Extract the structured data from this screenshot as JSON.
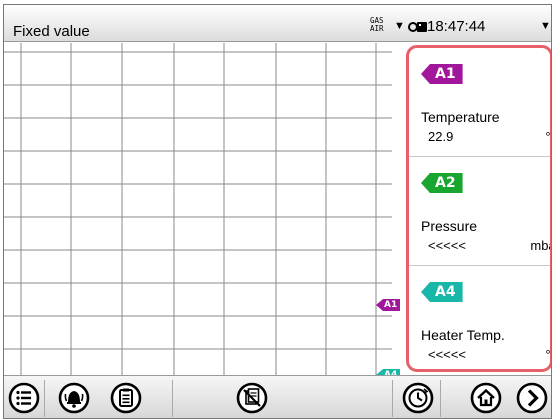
{
  "header": {
    "title": "Fixed value",
    "gas_label_top": "GAS",
    "gas_label_bottom": "AIR",
    "time": "18:47:44"
  },
  "chart_markers": [
    {
      "label": "A1",
      "color": "#a1169a"
    },
    {
      "label": "A4",
      "color": "#19b7a7"
    }
  ],
  "channels": [
    {
      "tag": "A1",
      "tag_color": "#a1169a",
      "name": "Temperature",
      "value": "22.9",
      "unit": "°C"
    },
    {
      "tag": "A2",
      "tag_color": "#18a530",
      "name": "Pressure",
      "value": "<<<<<",
      "unit": "mbar"
    },
    {
      "tag": "A4",
      "tag_color": "#19b7a7",
      "name": "Heater Temp.",
      "value": "<<<<<",
      "unit": "°C"
    }
  ],
  "panel_border_color": "#e65f69",
  "toolbar": {
    "icons": [
      "menu-list-icon",
      "alarm-bell-icon",
      "clipboard-icon",
      "no-documents-icon",
      "timer-clock-icon",
      "home-icon",
      "next-arrow-icon"
    ]
  }
}
